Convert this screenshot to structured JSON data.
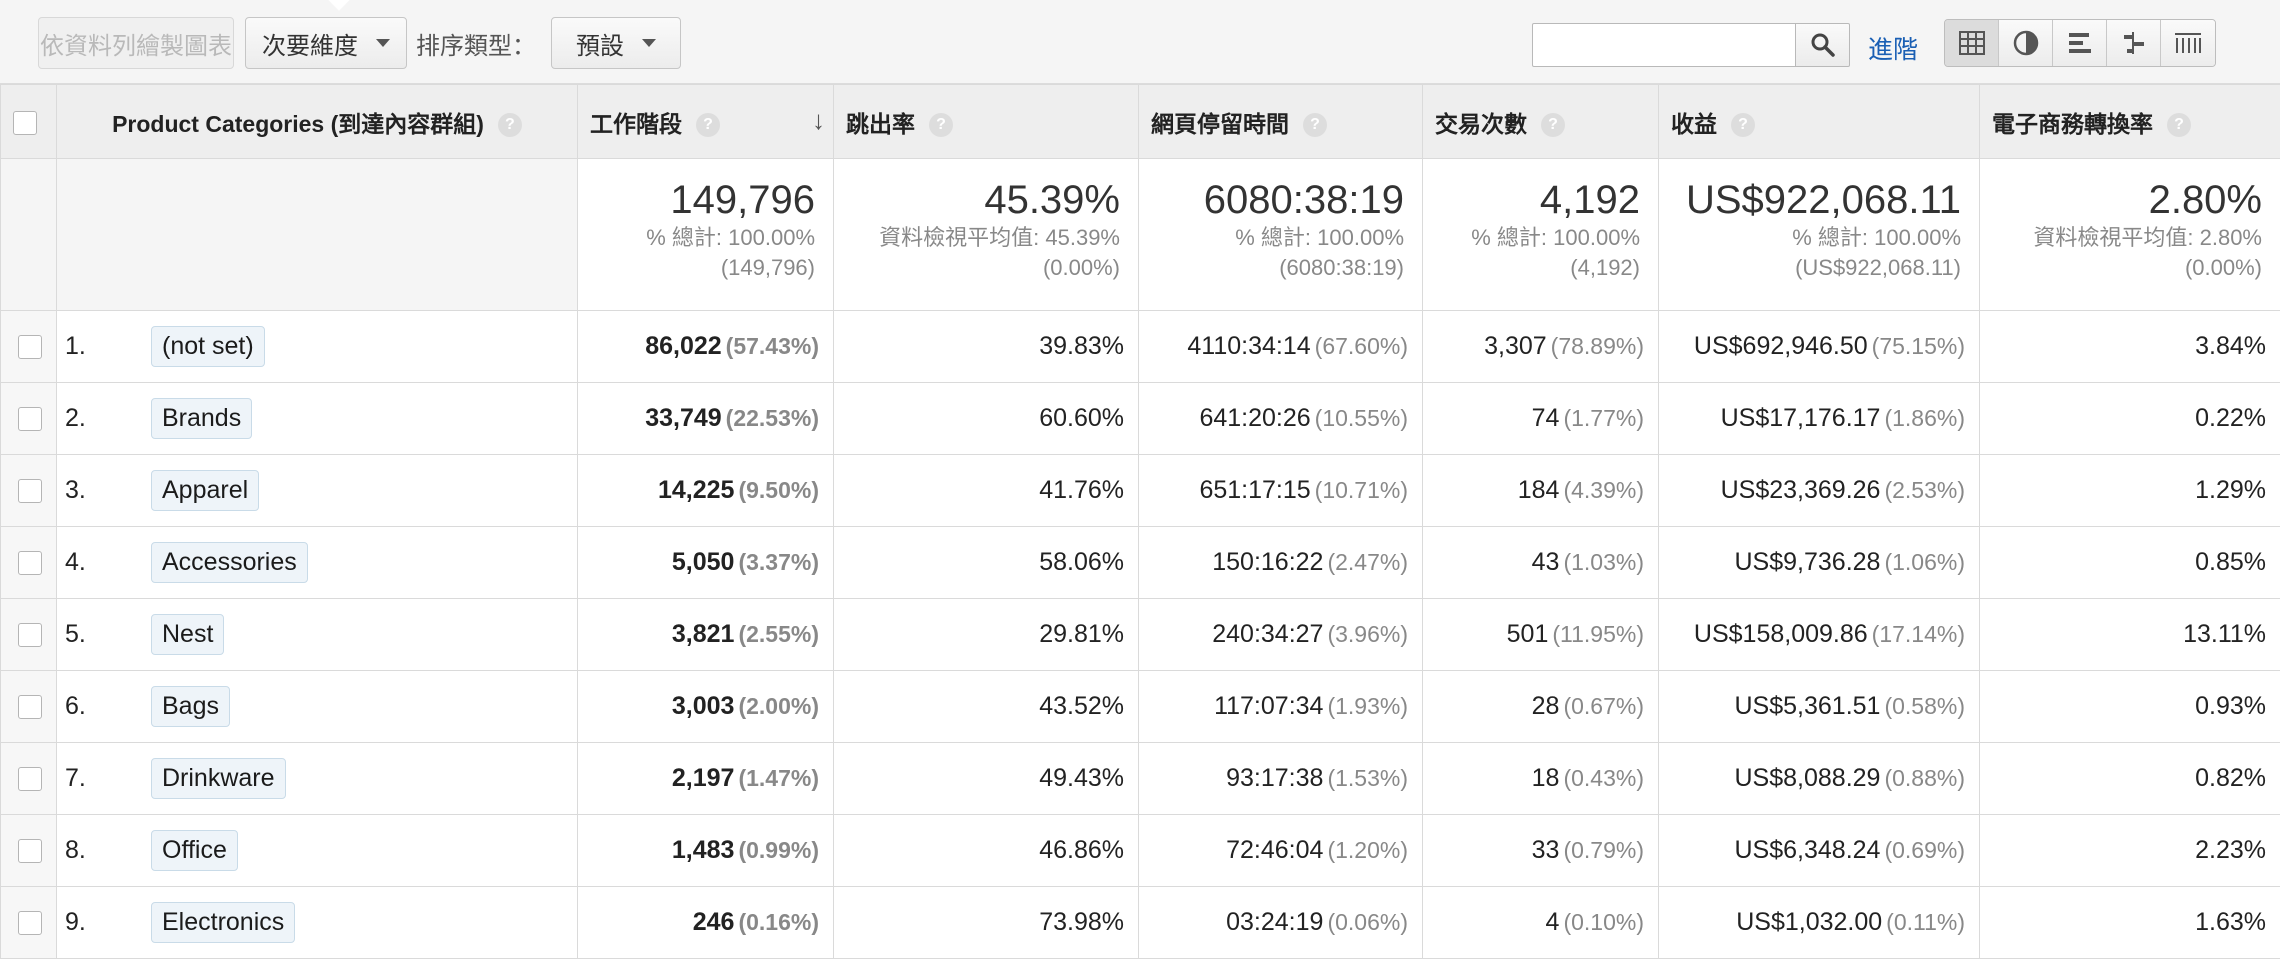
{
  "toolbar": {
    "plot_rows_label": "依資料列繪製圖表",
    "secondary_dim_label": "次要維度",
    "sort_type_label": "排序類型：",
    "sort_type_value": "預設",
    "search_placeholder": "",
    "advanced_label": "進階",
    "view_icons": [
      "table-view-icon",
      "pie-view-icon",
      "performance-view-icon",
      "comparison-view-icon",
      "pivot-view-icon"
    ]
  },
  "table": {
    "headers": {
      "dimension": "Product Categories (到達內容群組)",
      "sessions": "工作階段",
      "bounce_rate": "跳出率",
      "time_on_page": "網頁停留時間",
      "transactions": "交易次數",
      "revenue": "收益",
      "conversion_rate": "電子商務轉換率"
    },
    "help_glyph": "?",
    "sort_glyph": "↓",
    "totals": {
      "sessions": {
        "main": "149,796",
        "sub1": "% 總計: 100.00%",
        "sub2": "(149,796)"
      },
      "bounce_rate": {
        "main": "45.39%",
        "sub1": "資料檢視平均值: 45.39%",
        "sub2": "(0.00%)"
      },
      "time_on_page": {
        "main": "6080:38:19",
        "sub1": "% 總計: 100.00%",
        "sub2": "(6080:38:19)"
      },
      "transactions": {
        "main": "4,192",
        "sub1": "% 總計: 100.00%",
        "sub2": "(4,192)"
      },
      "revenue": {
        "main": "US$922,068.11",
        "sub1": "% 總計: 100.00%",
        "sub2": "(US$922,068.11)"
      },
      "conversion_rate": {
        "main": "2.80%",
        "sub1": "資料檢視平均值: 2.80%",
        "sub2": "(0.00%)"
      }
    },
    "rows": [
      {
        "rank": "1.",
        "category": "(not set)",
        "sessions": "86,022",
        "sessions_pct": "(57.43%)",
        "bounce_rate": "39.83%",
        "time": "4110:34:14",
        "time_pct": "(67.60%)",
        "transactions": "3,307",
        "transactions_pct": "(78.89%)",
        "revenue": "US$692,946.50",
        "revenue_pct": "(75.15%)",
        "conversion": "3.84%"
      },
      {
        "rank": "2.",
        "category": "Brands",
        "sessions": "33,749",
        "sessions_pct": "(22.53%)",
        "bounce_rate": "60.60%",
        "time": "641:20:26",
        "time_pct": "(10.55%)",
        "transactions": "74",
        "transactions_pct": "(1.77%)",
        "revenue": "US$17,176.17",
        "revenue_pct": "(1.86%)",
        "conversion": "0.22%"
      },
      {
        "rank": "3.",
        "category": "Apparel",
        "sessions": "14,225",
        "sessions_pct": "(9.50%)",
        "bounce_rate": "41.76%",
        "time": "651:17:15",
        "time_pct": "(10.71%)",
        "transactions": "184",
        "transactions_pct": "(4.39%)",
        "revenue": "US$23,369.26",
        "revenue_pct": "(2.53%)",
        "conversion": "1.29%"
      },
      {
        "rank": "4.",
        "category": "Accessories",
        "sessions": "5,050",
        "sessions_pct": "(3.37%)",
        "bounce_rate": "58.06%",
        "time": "150:16:22",
        "time_pct": "(2.47%)",
        "transactions": "43",
        "transactions_pct": "(1.03%)",
        "revenue": "US$9,736.28",
        "revenue_pct": "(1.06%)",
        "conversion": "0.85%"
      },
      {
        "rank": "5.",
        "category": "Nest",
        "sessions": "3,821",
        "sessions_pct": "(2.55%)",
        "bounce_rate": "29.81%",
        "time": "240:34:27",
        "time_pct": "(3.96%)",
        "transactions": "501",
        "transactions_pct": "(11.95%)",
        "revenue": "US$158,009.86",
        "revenue_pct": "(17.14%)",
        "conversion": "13.11%"
      },
      {
        "rank": "6.",
        "category": "Bags",
        "sessions": "3,003",
        "sessions_pct": "(2.00%)",
        "bounce_rate": "43.52%",
        "time": "117:07:34",
        "time_pct": "(1.93%)",
        "transactions": "28",
        "transactions_pct": "(0.67%)",
        "revenue": "US$5,361.51",
        "revenue_pct": "(0.58%)",
        "conversion": "0.93%"
      },
      {
        "rank": "7.",
        "category": "Drinkware",
        "sessions": "2,197",
        "sessions_pct": "(1.47%)",
        "bounce_rate": "49.43%",
        "time": "93:17:38",
        "time_pct": "(1.53%)",
        "transactions": "18",
        "transactions_pct": "(0.43%)",
        "revenue": "US$8,088.29",
        "revenue_pct": "(0.88%)",
        "conversion": "0.82%"
      },
      {
        "rank": "8.",
        "category": "Office",
        "sessions": "1,483",
        "sessions_pct": "(0.99%)",
        "bounce_rate": "46.86%",
        "time": "72:46:04",
        "time_pct": "(1.20%)",
        "transactions": "33",
        "transactions_pct": "(0.79%)",
        "revenue": "US$6,348.24",
        "revenue_pct": "(0.69%)",
        "conversion": "2.23%"
      },
      {
        "rank": "9.",
        "category": "Electronics",
        "sessions": "246",
        "sessions_pct": "(0.16%)",
        "bounce_rate": "73.98%",
        "time": "03:24:19",
        "time_pct": "(0.06%)",
        "transactions": "4",
        "transactions_pct": "(0.10%)",
        "revenue": "US$1,032.00",
        "revenue_pct": "(0.11%)",
        "conversion": "1.63%"
      }
    ]
  }
}
